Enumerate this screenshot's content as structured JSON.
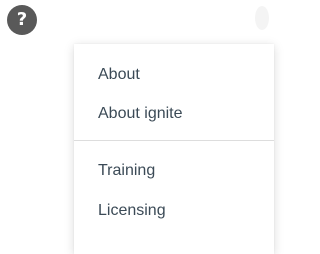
{
  "help_button": {
    "glyph": "?",
    "icon": "help-icon"
  },
  "menu": {
    "groups": [
      {
        "items": [
          {
            "label": "About"
          },
          {
            "label": "About ignite"
          }
        ]
      },
      {
        "items": [
          {
            "label": "Training"
          },
          {
            "label": "Licensing"
          }
        ]
      }
    ]
  },
  "colors": {
    "help_button_bg": "#595959",
    "menu_text": "#3b4a56",
    "divider": "#dddddd"
  }
}
